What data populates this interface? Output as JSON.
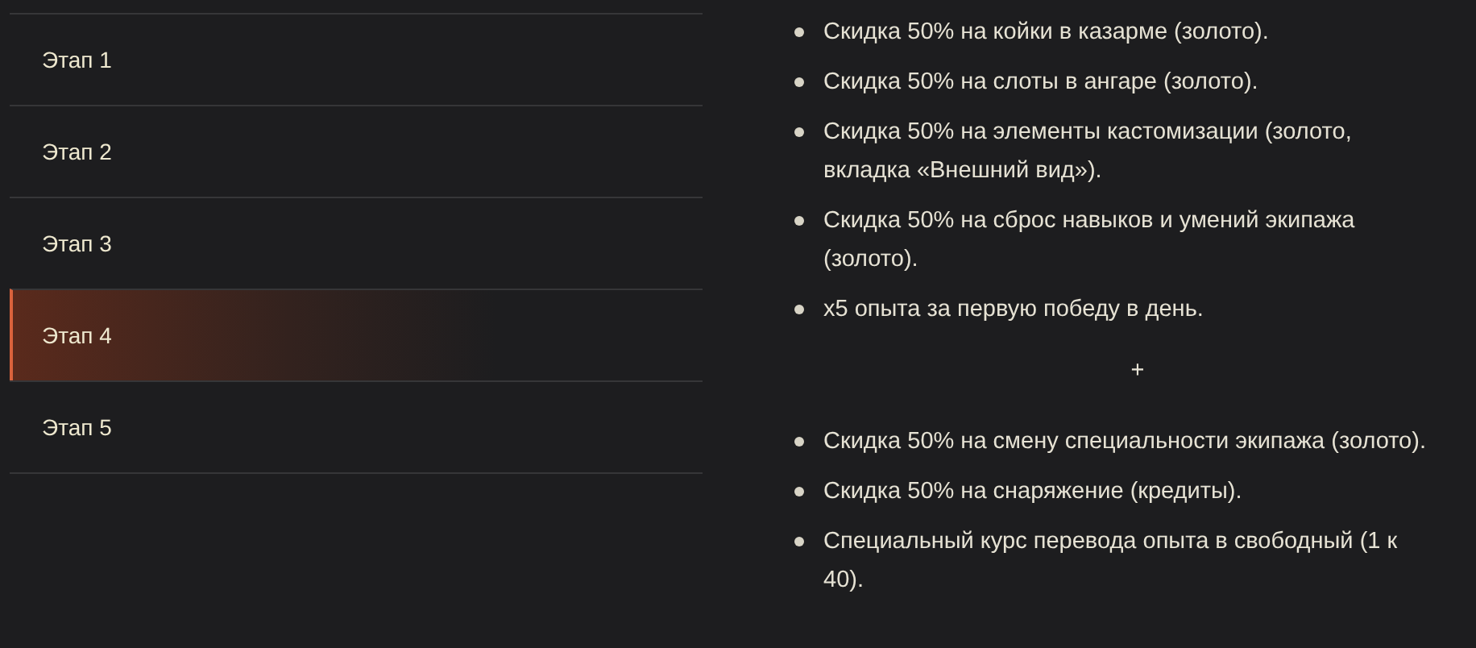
{
  "stages": [
    {
      "label": "Этап 1",
      "selected": false
    },
    {
      "label": "Этап 2",
      "selected": false
    },
    {
      "label": "Этап 3",
      "selected": false
    },
    {
      "label": "Этап 4",
      "selected": true
    },
    {
      "label": "Этап 5",
      "selected": false
    }
  ],
  "bonuses": [
    {
      "kind": "item",
      "text": "Скидка 50% на койки в казарме (золото)."
    },
    {
      "kind": "item",
      "text": "Скидка 50% на слоты в ангаре (золото)."
    },
    {
      "kind": "item",
      "text": "Скидка 50% на элементы кастомизации (золото, вкладка «Внешний вид»)."
    },
    {
      "kind": "item",
      "text": "Скидка 50% на сброс навыков и умений экипажа (золото)."
    },
    {
      "kind": "item",
      "text": "x5 опыта за первую победу в день."
    },
    {
      "kind": "separator",
      "text": "+"
    },
    {
      "kind": "item",
      "text": "Скидка 50% на смену специальности экипажа (золото)."
    },
    {
      "kind": "item",
      "text": "Скидка 50% на снаряжение (кредиты)."
    },
    {
      "kind": "item",
      "text": "Специальный курс перевода опыта в свободный (1 к 40)."
    }
  ]
}
